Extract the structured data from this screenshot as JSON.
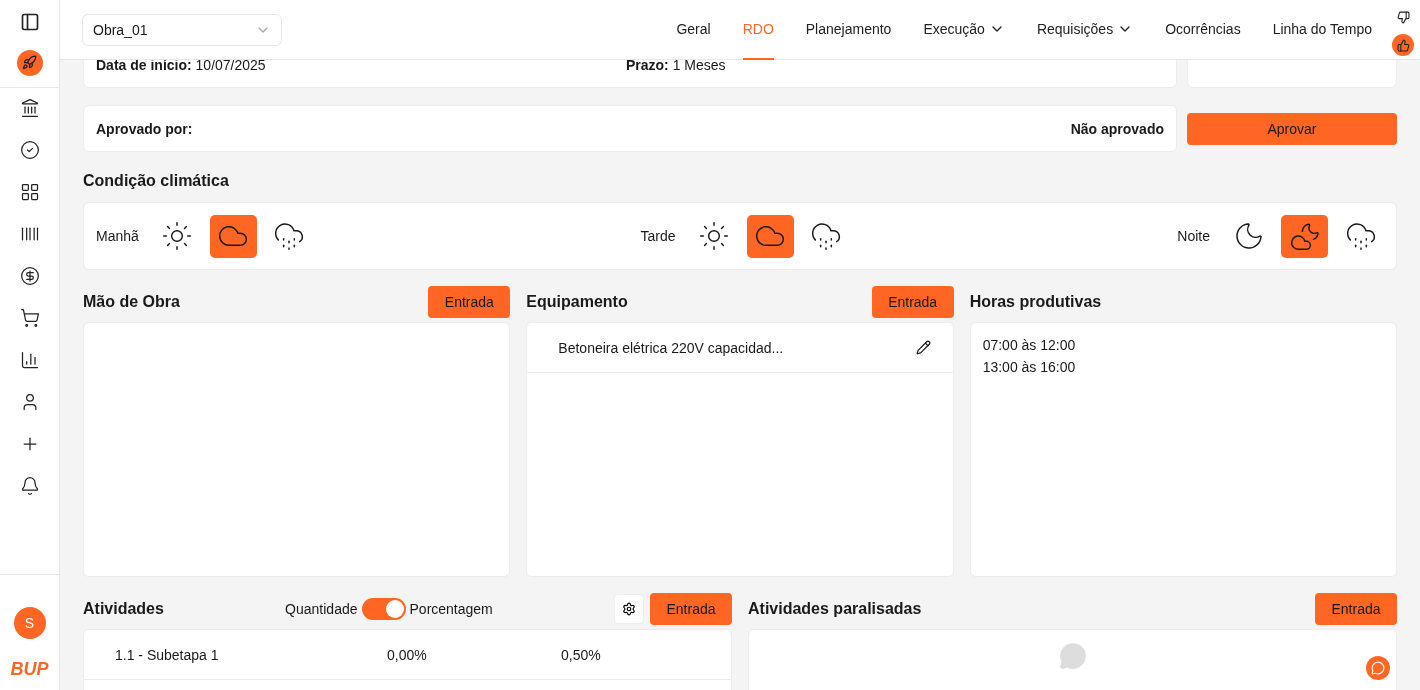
{
  "sidebar": {
    "logo": "BUP",
    "avatar": "S",
    "items": [
      {
        "kind": "bank"
      },
      {
        "kind": "check"
      },
      {
        "kind": "grid"
      },
      {
        "kind": "barcode"
      },
      {
        "kind": "dollar"
      },
      {
        "kind": "cart"
      },
      {
        "kind": "chart"
      },
      {
        "kind": "user"
      },
      {
        "kind": "plus"
      },
      {
        "kind": "bell"
      }
    ]
  },
  "project_select": {
    "value": "Obra_01"
  },
  "nav": [
    {
      "label": "Geral",
      "selected": false,
      "dropdown": false
    },
    {
      "label": "RDO",
      "selected": true,
      "dropdown": false
    },
    {
      "label": "Planejamento",
      "selected": false,
      "dropdown": false
    },
    {
      "label": "Execução",
      "selected": false,
      "dropdown": true
    },
    {
      "label": "Requisições",
      "selected": false,
      "dropdown": true
    },
    {
      "label": "Ocorrências",
      "selected": false,
      "dropdown": false
    },
    {
      "label": "Linha do Tempo",
      "selected": false,
      "dropdown": false
    }
  ],
  "feedback": [
    {
      "kind": "down",
      "selected": false
    },
    {
      "kind": "up",
      "selected": true
    }
  ],
  "info": {
    "start_label": "Data de início:",
    "start_value": "10/07/2025",
    "term_label": "Prazo:",
    "term_value": "1 Meses"
  },
  "approval": {
    "label": "Aprovado por:",
    "status": "Não aprovado",
    "button": "Aprovar"
  },
  "weather": {
    "title": "Condição climática",
    "periods": [
      {
        "label": "Manhã",
        "options": [
          {
            "kind": "sun",
            "selected": false
          },
          {
            "kind": "cloud",
            "selected": true
          },
          {
            "kind": "rain",
            "selected": false
          }
        ]
      },
      {
        "label": "Tarde",
        "options": [
          {
            "kind": "sun",
            "selected": false
          },
          {
            "kind": "cloud",
            "selected": true
          },
          {
            "kind": "rain",
            "selected": false
          }
        ]
      },
      {
        "label": "Noite",
        "options": [
          {
            "kind": "moon",
            "selected": false
          },
          {
            "kind": "cloud-moon",
            "selected": true
          },
          {
            "kind": "rain",
            "selected": false
          }
        ]
      }
    ]
  },
  "labor": {
    "title": "Mão de Obra",
    "button": "Entrada"
  },
  "equipment": {
    "title": "Equipamento",
    "button": "Entrada",
    "items": [
      "Betoneira elétrica 220V capacidad..."
    ]
  },
  "hours": {
    "title": "Horas produtivas",
    "items": [
      "07:00 às 12:00",
      "13:00 às 16:00"
    ]
  },
  "activities": {
    "title": "Atividades",
    "toggle_left": "Quantidade",
    "toggle_right": "Porcentagem",
    "toggle_on": true,
    "button": "Entrada",
    "rows": [
      {
        "name": "1.1 - Subetapa 1",
        "column_2": "0,00%",
        "column_3": "0,50%"
      }
    ]
  },
  "stopped": {
    "title": "Atividades paralisadas",
    "button": "Entrada"
  }
}
